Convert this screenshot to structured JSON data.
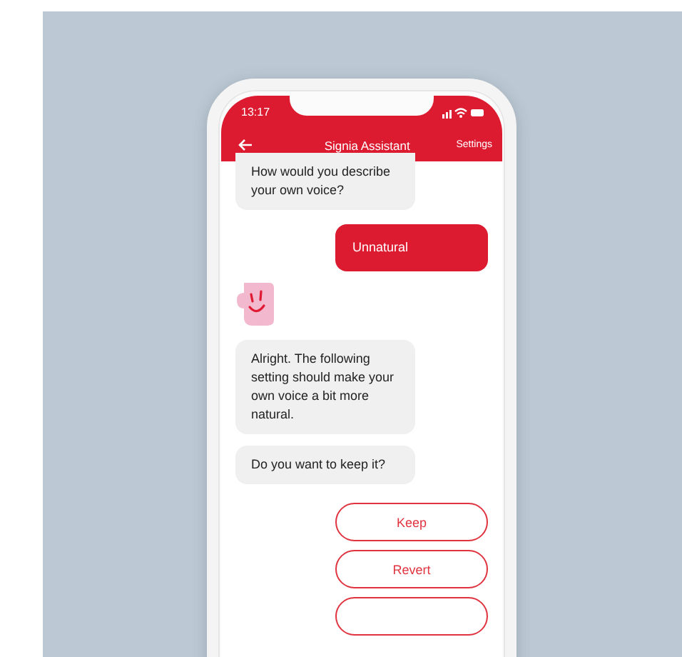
{
  "status_bar": {
    "time": "13:17"
  },
  "header": {
    "title": "Signia Assistant",
    "action": "Settings"
  },
  "messages": [
    {
      "kind": "bot",
      "text": "How would you describe your own voice?"
    },
    {
      "kind": "user",
      "text": "Unnatural"
    },
    {
      "kind": "avatar"
    },
    {
      "kind": "bot",
      "text": "Alright. The following setting should make your own voice a bit more natural."
    },
    {
      "kind": "bot",
      "text": "Do you want to keep it?"
    }
  ],
  "replies": [
    "Keep",
    "Revert"
  ]
}
